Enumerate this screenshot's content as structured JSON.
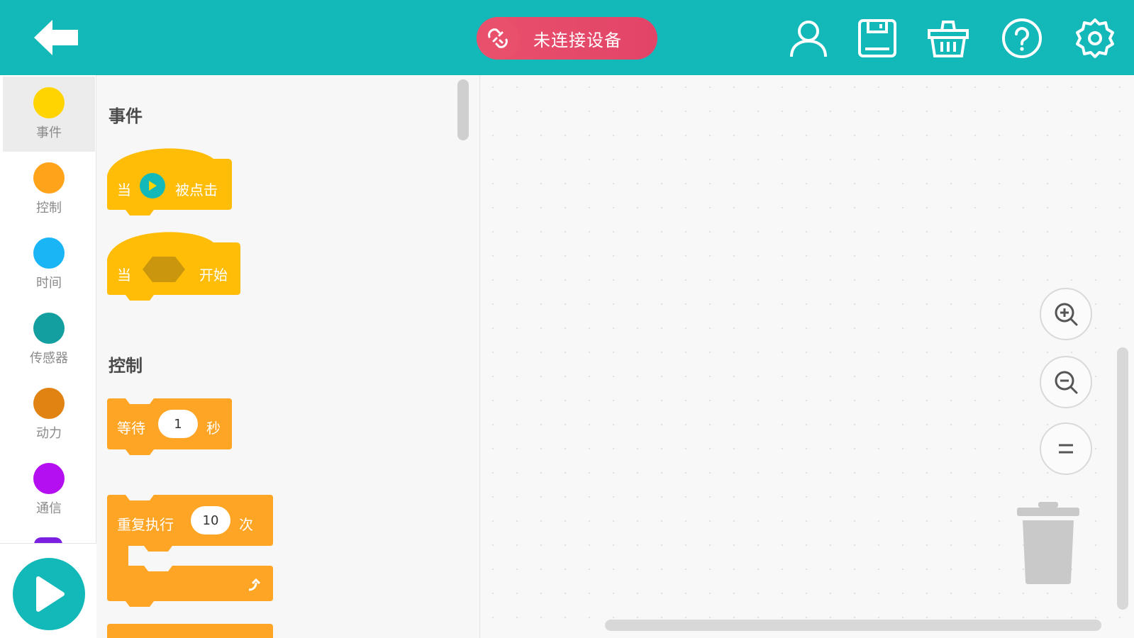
{
  "header": {
    "connection_status": "未连接设备",
    "icons": [
      "back-arrow-icon",
      "unlink-icon",
      "user-icon",
      "save-icon",
      "basket-icon",
      "help-icon",
      "settings-icon"
    ]
  },
  "categories": [
    {
      "label": "事件",
      "color": "#ffd400"
    },
    {
      "label": "控制",
      "color": "#ffa31a"
    },
    {
      "label": "时间",
      "color": "#19b5f5"
    },
    {
      "label": "传感器",
      "color": "#139ea0"
    },
    {
      "label": "动力",
      "color": "#e08313"
    },
    {
      "label": "通信",
      "color": "#b40ff0"
    }
  ],
  "palette": {
    "events_title": "事件",
    "control_title": "控制",
    "block_when_clicked": {
      "prefix": "当",
      "suffix": "被点击"
    },
    "block_when_start": {
      "prefix": "当",
      "suffix": "开始"
    },
    "block_wait": {
      "prefix": "等待",
      "value": "1",
      "suffix": "秒"
    },
    "block_repeat": {
      "prefix": "重复执行",
      "value": "10",
      "suffix": "次"
    }
  },
  "colors": {
    "accent": "#13b9b9",
    "event_block": "#ffbd08",
    "control_block": "#ffa526",
    "status_pill": "#e24468"
  }
}
